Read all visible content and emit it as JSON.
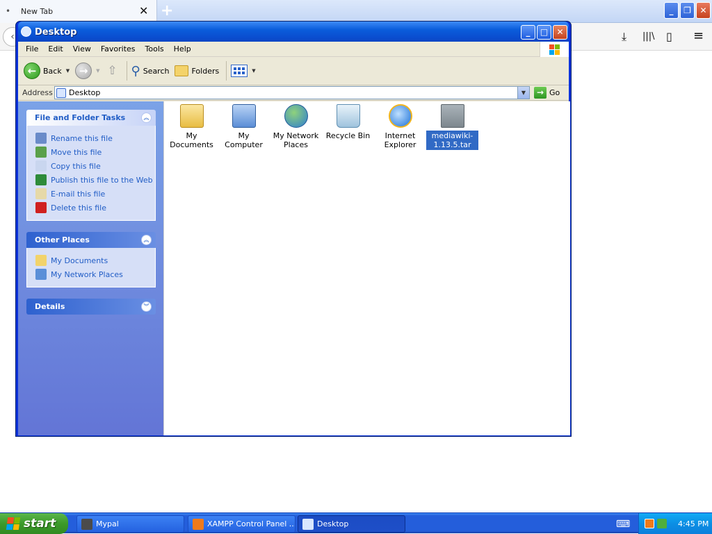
{
  "browser": {
    "tab_title": "New Tab",
    "tab_close": "✕",
    "newtab": "+",
    "tab_dot": "•",
    "min": "_",
    "restore": "❐",
    "close": "✕",
    "back": "‹",
    "download": "⤓",
    "library": "|||\\",
    "sidebar": "▯",
    "menu": "≡"
  },
  "window": {
    "title": "Desktop",
    "min": "_",
    "max": "□",
    "close": "✕"
  },
  "menu": [
    "File",
    "Edit",
    "View",
    "Favorites",
    "Tools",
    "Help"
  ],
  "toolbar": {
    "back": "Back",
    "search": "Search",
    "folders": "Folders",
    "back_arrow": "←",
    "fwd_arrow": "→",
    "up_arrow": "⇧",
    "search_glyph": "⚲",
    "caret": "▼"
  },
  "address": {
    "label": "Address",
    "value": "Desktop",
    "go": "Go",
    "go_arrow": "→",
    "drop": "▼"
  },
  "tasks": {
    "file_folder": {
      "title": "File and Folder Tasks",
      "chev": "︽",
      "items": [
        {
          "label": "Rename this file",
          "icon": "rename-icon",
          "color": "#6a8bc9"
        },
        {
          "label": "Move this file",
          "icon": "move-icon",
          "color": "#5aa04a"
        },
        {
          "label": "Copy this file",
          "icon": "copy-icon",
          "color": "#c9d6ef"
        },
        {
          "label": "Publish this file to the Web",
          "icon": "publish-icon",
          "color": "#2e8b3a"
        },
        {
          "label": "E-mail this file",
          "icon": "email-icon",
          "color": "#e6d9a8"
        },
        {
          "label": "Delete this file",
          "icon": "delete-icon",
          "color": "#d02020"
        }
      ]
    },
    "other_places": {
      "title": "Other Places",
      "chev": "︽",
      "items": [
        {
          "label": "My Documents",
          "icon": "my-documents-icon",
          "color": "#f2d36b"
        },
        {
          "label": "My Network Places",
          "icon": "network-places-icon",
          "color": "#5b8fd8"
        }
      ]
    },
    "details": {
      "title": "Details",
      "chev": "︾"
    }
  },
  "files": [
    {
      "label": "My Documents",
      "icon": "my-documents-icon",
      "selected": false
    },
    {
      "label": "My Computer",
      "icon": "my-computer-icon",
      "selected": false
    },
    {
      "label": "My Network Places",
      "icon": "network-places-icon",
      "selected": false
    },
    {
      "label": "Recycle Bin",
      "icon": "recycle-bin-icon",
      "selected": false
    },
    {
      "label": "Internet Explorer",
      "icon": "internet-explorer-icon",
      "selected": false
    },
    {
      "label": "mediawiki-1.13.5.tar",
      "icon": "gz-archive-icon",
      "selected": true
    }
  ],
  "taskbar": {
    "start": "start",
    "buttons": [
      {
        "label": "Mypal",
        "icon": "mypal-icon",
        "active": false
      },
      {
        "label": "XAMPP Control Panel ...",
        "icon": "xampp-icon",
        "active": false
      },
      {
        "label": "Desktop",
        "icon": "desktop-window-icon",
        "active": true
      }
    ],
    "keyboard": "⌨",
    "time": "4:45 PM"
  }
}
